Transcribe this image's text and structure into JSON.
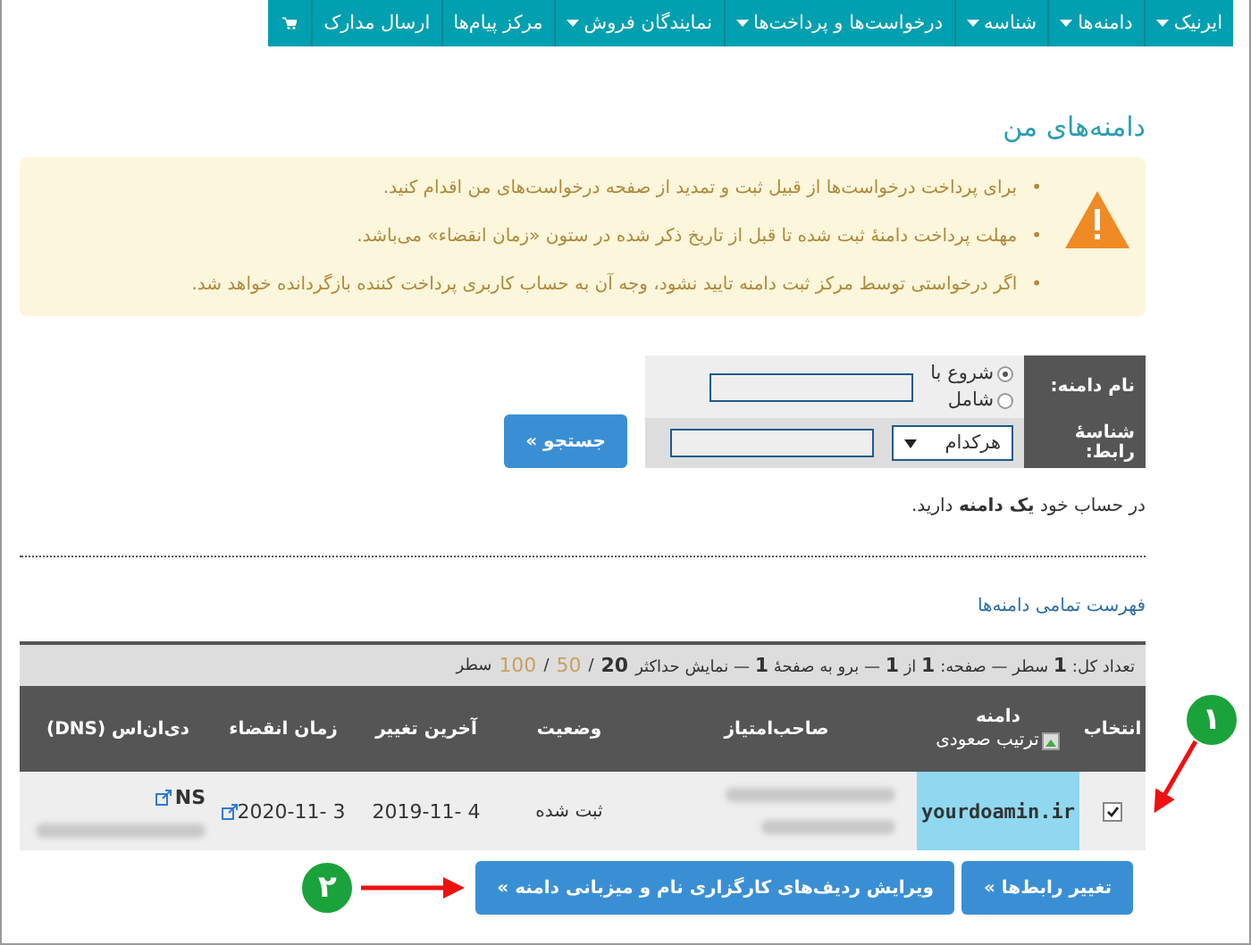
{
  "nav": {
    "items": [
      {
        "label": "ایرنیک",
        "dropdown": true
      },
      {
        "label": "دامنه‌ها",
        "dropdown": true
      },
      {
        "label": "شناسه",
        "dropdown": true
      },
      {
        "label": "درخواست‌ها و پرداخت‌ها",
        "dropdown": true
      },
      {
        "label": "نمایندگان فروش",
        "dropdown": true
      },
      {
        "label": "مرکز پیام‌ها",
        "dropdown": false
      },
      {
        "label": "ارسال مدارک",
        "dropdown": false
      }
    ]
  },
  "title": "دامنه‌های من",
  "warning": {
    "items": [
      {
        "marker": "•",
        "text": "برای پرداخت درخواست‌ها از قبیل ثبت و تمدید از صفحه درخواست‌های من اقدام کنید."
      },
      {
        "marker": "•",
        "text": "مهلت پرداخت دامنهٔ ثبت شده تا قبل از تاریخ ذکر شده در ستون «زمان انقضاء» می‌باشد."
      },
      {
        "marker": "•",
        "text": "اگر درخواستی توسط مرکز ثبت دامنه تایید نشود، وجه آن به حساب کاربری پرداخت کننده بازگردانده خواهد شد."
      }
    ]
  },
  "search": {
    "domain_label": "نام دامنه:",
    "match_options": [
      {
        "label": "شروع با",
        "selected": true
      },
      {
        "label": "شامل",
        "selected": false
      }
    ],
    "contact_label": "شناسهٔ رابط:",
    "contact_select": "هرکدام",
    "button": "جستجو »"
  },
  "summary": "در حساب خود **یک دامنه** دارید.",
  "list_link": "فهرست تمامی دامنه‌ها",
  "pager": {
    "text": "تعداد کل: **1** سطر — صفحه: **1** از **1** — برو به صفحهٔ **1** — نمایش حداکثر",
    "page_sizes": [
      {
        "label": "20",
        "selected": true
      },
      {
        "label": "50",
        "selected": false
      },
      {
        "label": "100",
        "selected": false
      }
    ],
    "separators": [
      "/",
      "/"
    ],
    "suffix": "سطر"
  },
  "table": {
    "columns": [
      {
        "label": "انتخاب"
      },
      {
        "label": "دامنه",
        "sort_alt": "ترتیب صعودی"
      },
      {
        "label": "صاحب‌امتیاز"
      },
      {
        "label": "وضعیت"
      },
      {
        "label": "آخرین تغییر"
      },
      {
        "label": "زمان انقضاء"
      },
      {
        "label": "دی‌ان‌اس (DNS)"
      }
    ],
    "rows": [
      {
        "checked": true,
        "domain": "yourdoamin.ir",
        "status": "ثبت شده",
        "last_change": "2019-11- 4",
        "expiry": "2020-11- 3",
        "dns": "NS"
      }
    ]
  },
  "actions": [
    "تغییر رابط‌ها »",
    "ویرایش ردیف‌های کارگزاری نام و میزبانی دامنه »"
  ],
  "annotations": [
    {
      "label": "۱"
    },
    {
      "label": "۲"
    }
  ]
}
